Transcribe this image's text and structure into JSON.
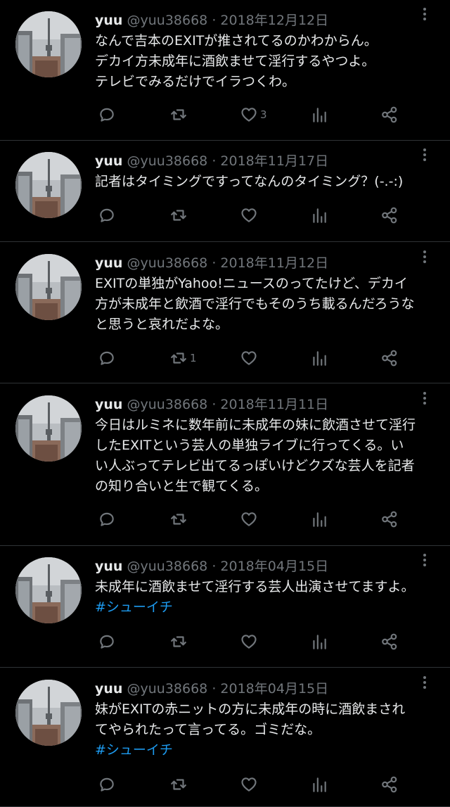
{
  "tweets": [
    {
      "name": "yuu",
      "handle": "@yuu38668",
      "dot": "·",
      "date": "2018年12月12日",
      "lines": [
        "なんで吉本のEXITが推されてるのかわからん。",
        "デカイ方未成年に酒飲ませて淫行するやつよ。",
        "テレビでみるだけでイラつくわ。"
      ],
      "hashtag": "",
      "replies": "",
      "retweets": "",
      "likes": "3"
    },
    {
      "name": "yuu",
      "handle": "@yuu38668",
      "dot": "·",
      "date": "2018年11月17日",
      "lines": [
        "記者はタイミングですってなんのタイミング？(-.-:)"
      ],
      "hashtag": "",
      "replies": "",
      "retweets": "",
      "likes": ""
    },
    {
      "name": "yuu",
      "handle": "@yuu38668",
      "dot": "·",
      "date": "2018年11月12日",
      "lines": [
        "EXITの単独がYahoo!ニュースのってたけど、デカイ",
        "方が未成年と飲酒で淫行でもそのうち載るんだろうな",
        "と思うと哀れだよな。"
      ],
      "hashtag": "",
      "replies": "",
      "retweets": "1",
      "likes": ""
    },
    {
      "name": "yuu",
      "handle": "@yuu38668",
      "dot": "·",
      "date": "2018年11月11日",
      "lines": [
        "今日はルミネに数年前に未成年の妹に飲酒させて淫行",
        "したEXITという芸人の単独ライブに行ってくる。い",
        "い人ぶってテレビ出てるっぽいけどクズな芸人を記者",
        "の知り合いと生で観てくる。"
      ],
      "hashtag": "",
      "replies": "",
      "retweets": "",
      "likes": ""
    },
    {
      "name": "yuu",
      "handle": "@yuu38668",
      "dot": "·",
      "date": "2018年04月15日",
      "lines": [
        "未成年に酒飲ませて淫行する芸人出演させてますよ。"
      ],
      "hashtag": "#シューイチ",
      "replies": "",
      "retweets": "",
      "likes": ""
    },
    {
      "name": "yuu",
      "handle": "@yuu38668",
      "dot": "·",
      "date": "2018年04月15日",
      "lines": [
        "妹がEXITの赤ニットの方に未成年の時に酒飲まされ",
        "てやられたって言ってる。ゴミだな。"
      ],
      "hashtag": "#シューイチ",
      "replies": "",
      "retweets": "",
      "likes": ""
    }
  ],
  "icons": {
    "reply": "speech-bubble",
    "retweet": "retweet-arrows",
    "like": "heart",
    "views": "bar-chart",
    "share": "share-nodes",
    "more": "vertical-dots"
  },
  "colors": {
    "background": "#000000",
    "text": "#e7e9ea",
    "muted": "#71767b",
    "link": "#1d9bf0"
  }
}
